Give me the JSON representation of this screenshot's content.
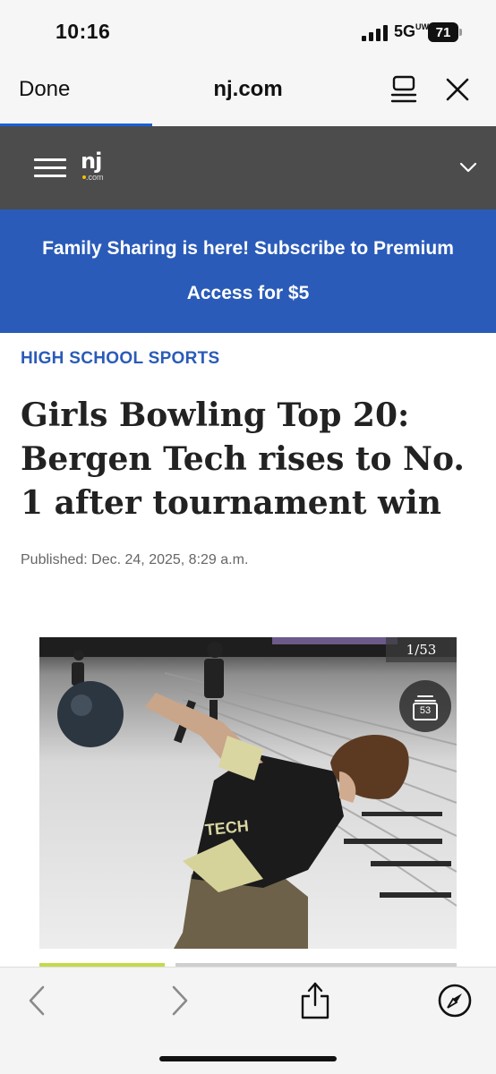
{
  "status_bar": {
    "time": "10:16",
    "network": "5G",
    "network_suffix": "UW",
    "battery": "71"
  },
  "browser": {
    "done_label": "Done",
    "domain": "nj.com"
  },
  "site": {
    "logo_main": "nj",
    "logo_sub": ".com"
  },
  "promo": {
    "text": "Family Sharing is here! Subscribe to Premium Access for $5"
  },
  "article": {
    "section": "HIGH SCHOOL SPORTS",
    "headline": "Girls Bowling Top 20: Bergen Tech rises to No. 1 after tournament win",
    "published": "Published: Dec. 24, 2025, 8:29 a.m."
  },
  "gallery": {
    "counter": "1/53",
    "count": "53",
    "shirt_text": "TECH"
  },
  "colors": {
    "accent": "#2a5bb8",
    "header": "#4c4c4c",
    "strip_accent": "#c6d94a"
  },
  "icons": {
    "back": "chevron-left-icon",
    "forward": "chevron-right-icon",
    "share": "share-icon",
    "compass": "compass-icon",
    "reader": "reader-icon",
    "close": "close-icon",
    "menu": "hamburger-icon"
  }
}
